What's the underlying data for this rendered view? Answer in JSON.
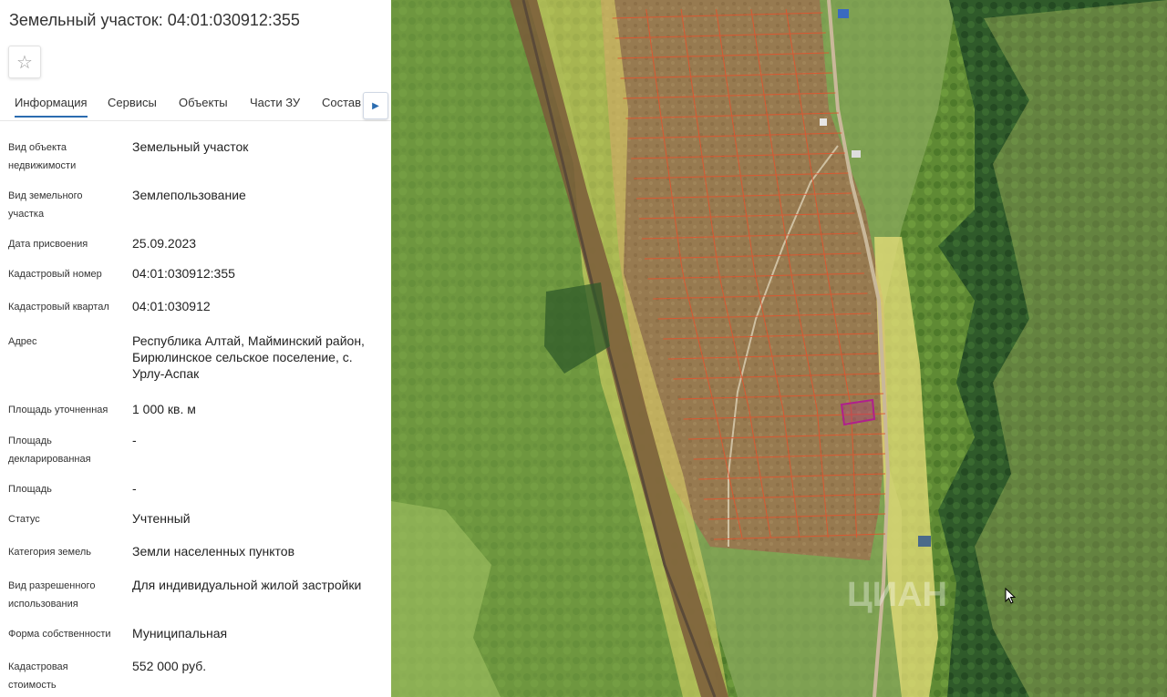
{
  "header": {
    "title": "Земельный участок: 04:01:030912:355",
    "favorite_icon": "star-outline-icon"
  },
  "tabs": [
    {
      "label": "Информация",
      "active": true
    },
    {
      "label": "Сервисы",
      "active": false
    },
    {
      "label": "Объекты",
      "active": false
    },
    {
      "label": "Части ЗУ",
      "active": false
    },
    {
      "label": "Состав",
      "active": false
    }
  ],
  "tabs_next_icon": "caret-right-icon",
  "info": {
    "object_type": {
      "label": "Вид объекта недвижимости",
      "value": "Земельный участок"
    },
    "land_type": {
      "label": "Вид земельного участка",
      "value": "Землепользование"
    },
    "assign_date": {
      "label": "Дата присвоения",
      "value": "25.09.2023"
    },
    "cadastral_no": {
      "label": "Кадастровый номер",
      "value": "04:01:030912:355"
    },
    "quarter": {
      "label": "Кадастровый квартал",
      "value": "04:01:030912"
    },
    "address": {
      "label": "Адрес",
      "value": "Республика Алтай, Майминский район, Бирюлинское сельское поселение, с. Урлу-Аспак"
    },
    "area_specified": {
      "label": "Площадь уточненная",
      "value": "1 000 кв. м"
    },
    "area_declared": {
      "label": "Площадь декларированная",
      "value": "-"
    },
    "area": {
      "label": "Площадь",
      "value": "-"
    },
    "status": {
      "label": "Статус",
      "value": "Учтенный"
    },
    "land_category": {
      "label": "Категория земель",
      "value": "Земли населенных пунктов"
    },
    "permitted_use": {
      "label": "Вид разрешенного использования",
      "value": "Для индивидуальной жилой застройки"
    },
    "ownership": {
      "label": "Форма собственности",
      "value": "Муниципальная"
    },
    "cadastral_cost": {
      "label": "Кадастровая стоимость",
      "value": "552 000 руб."
    }
  },
  "map": {
    "view": "satellite",
    "selected_parcel_color": "#b0208c",
    "parcel_outline_color": "#e0552f",
    "zone_fill_color": "#e8e070",
    "watermark": "ЦИАН",
    "cursor_icon": "mouse-pointer-icon"
  }
}
